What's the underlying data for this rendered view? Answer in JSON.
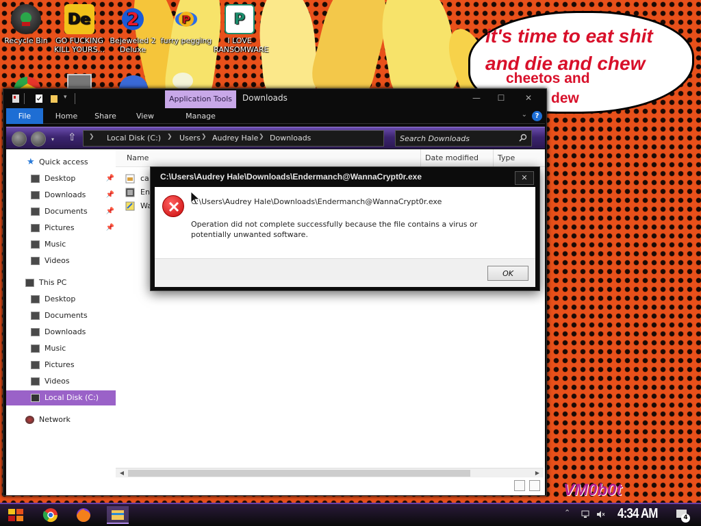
{
  "desktop": {
    "icons": [
      {
        "label": "Recycle Bin"
      },
      {
        "label": "GO FUCKING KILL YOURS..."
      },
      {
        "label": "Bejeweled 2 Deluxe"
      },
      {
        "label": "furry pegging"
      },
      {
        "label": "I LOVE RANSOMWARE"
      }
    ],
    "bubble": {
      "line1": "it's time to eat shit",
      "line2": "and die and chew",
      "line3": "cheetos and",
      "line4": "ntain dew"
    },
    "watermark": "VM0b0t"
  },
  "explorer": {
    "ribbon_context_label": "Application Tools",
    "title": "Downloads",
    "tabs": [
      {
        "label": "File"
      },
      {
        "label": "Home"
      },
      {
        "label": "Share"
      },
      {
        "label": "View"
      },
      {
        "label": "Manage"
      }
    ],
    "breadcrumb": [
      "Local Disk (C:)",
      "Users",
      "Audrey Hale",
      "Downloads"
    ],
    "search_placeholder": "Search Downloads",
    "nav": {
      "quick_access": {
        "label": "Quick access",
        "items": [
          {
            "label": "Desktop",
            "pinned": true
          },
          {
            "label": "Downloads",
            "pinned": true
          },
          {
            "label": "Documents",
            "pinned": true
          },
          {
            "label": "Pictures",
            "pinned": true
          },
          {
            "label": "Music",
            "pinned": false
          },
          {
            "label": "Videos",
            "pinned": false
          }
        ]
      },
      "this_pc": {
        "label": "This PC",
        "items": [
          {
            "label": "Desktop"
          },
          {
            "label": "Documents"
          },
          {
            "label": "Downloads"
          },
          {
            "label": "Music"
          },
          {
            "label": "Pictures"
          },
          {
            "label": "Videos"
          },
          {
            "label": "Local Disk (C:)"
          }
        ]
      },
      "network": {
        "label": "Network"
      }
    },
    "columns": [
      {
        "label": "Name"
      },
      {
        "label": "Date modified"
      },
      {
        "label": "Type"
      }
    ],
    "files": [
      {
        "label": "ca"
      },
      {
        "label": "En"
      },
      {
        "label": "Wa"
      }
    ]
  },
  "dialog": {
    "title": "C:\\Users\\Audrey Hale\\Downloads\\Endermanch@WannaCrypt0r.exe",
    "path": "C:\\Users\\Audrey Hale\\Downloads\\Endermanch@WannaCrypt0r.exe",
    "message": "Operation did not complete successfully because the file contains a virus or potentially unwanted software.",
    "ok_label": "OK",
    "close_label": "✕"
  },
  "taskbar": {
    "clock": "4:34 AM",
    "notification_count": "4"
  },
  "colors": {
    "accent": "#9a62c8",
    "file_tab": "#1e6ed4",
    "bubble_text": "#d8102a",
    "wallpaper": "#e8501a"
  }
}
